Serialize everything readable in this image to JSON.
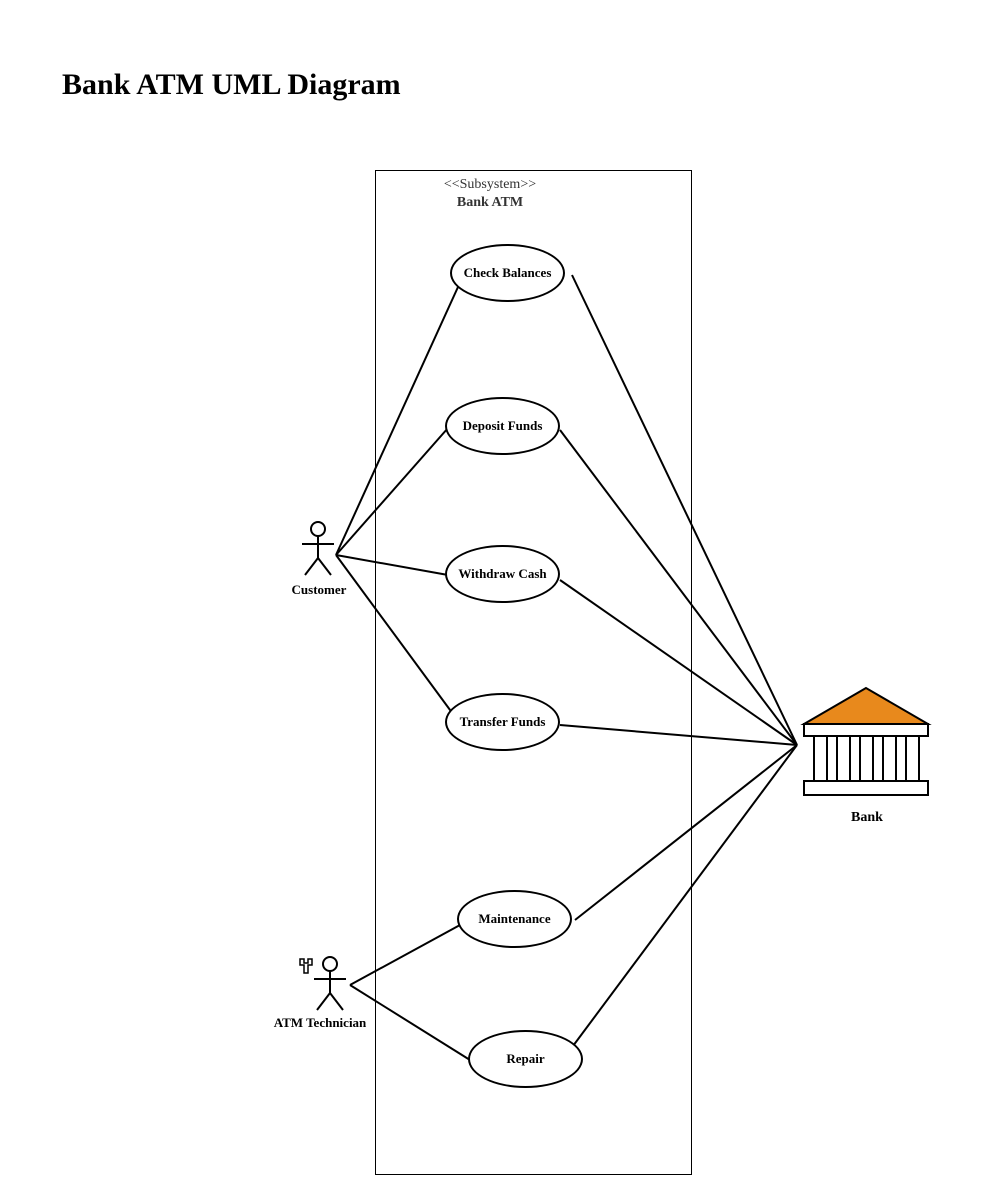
{
  "title": "Bank ATM UML Diagram",
  "subsystem": {
    "stereotype": "<<Subsystem>>",
    "name": "Bank ATM"
  },
  "use_cases": {
    "check_balances": "Check Balances",
    "deposit_funds": "Deposit Funds",
    "withdraw_cash": "Withdraw Cash",
    "transfer_funds": "Transfer Funds",
    "maintenance": "Maintenance",
    "repair": "Repair"
  },
  "actors": {
    "customer": "Customer",
    "atm_technician": "ATM Technician",
    "bank": "Bank"
  },
  "associations": {
    "customer": [
      "check_balances",
      "deposit_funds",
      "withdraw_cash",
      "transfer_funds"
    ],
    "atm_technician": [
      "maintenance",
      "repair"
    ],
    "bank": [
      "check_balances",
      "deposit_funds",
      "withdraw_cash",
      "transfer_funds",
      "maintenance",
      "repair"
    ]
  }
}
